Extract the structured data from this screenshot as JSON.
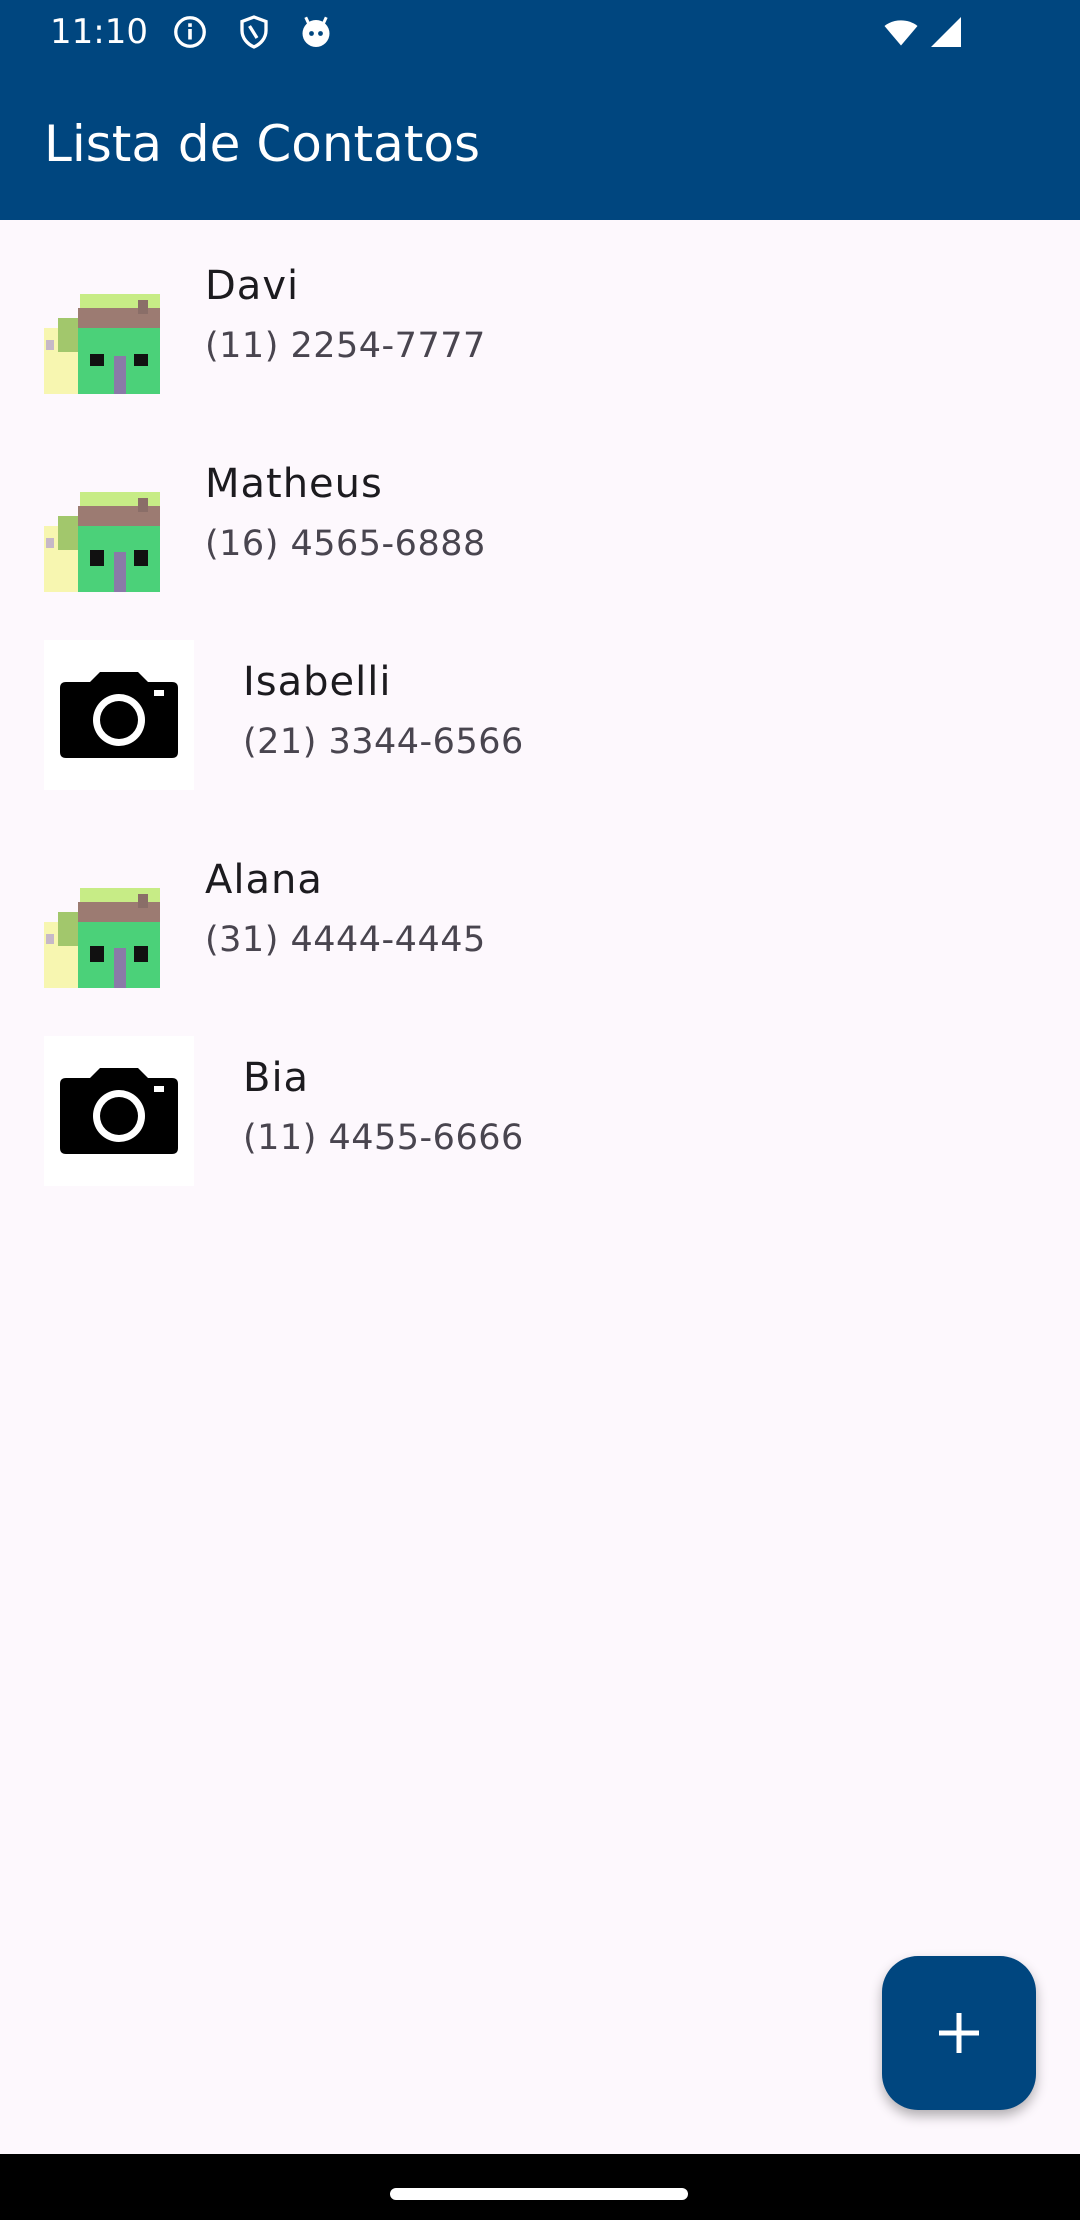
{
  "status_bar": {
    "time": "11:10",
    "left_icons": [
      "info-icon",
      "shield-icon",
      "android-icon"
    ],
    "right_icons": [
      "wifi-icon",
      "signal-icon"
    ]
  },
  "app_bar": {
    "title": "Lista de Contatos",
    "background": "#00467f"
  },
  "contacts": [
    {
      "name": "Davi",
      "phone": "(11) 2254-7777",
      "avatar": "pixel-house-icon"
    },
    {
      "name": "Matheus",
      "phone": "(16) 4565-6888",
      "avatar": "pixel-house-icon"
    },
    {
      "name": "Isabelli",
      "phone": "(21) 3344-6566",
      "avatar": "camera-icon"
    },
    {
      "name": "Alana",
      "phone": "(31) 4444-4445",
      "avatar": "pixel-house-icon"
    },
    {
      "name": "Bia",
      "phone": "(11) 4455-6666",
      "avatar": "camera-icon"
    }
  ],
  "fab": {
    "icon": "plus-icon",
    "background": "#00467f"
  },
  "colors": {
    "page_background": "#fdf8fd",
    "name_text": "#1c1b1f",
    "phone_text": "#49454f"
  }
}
